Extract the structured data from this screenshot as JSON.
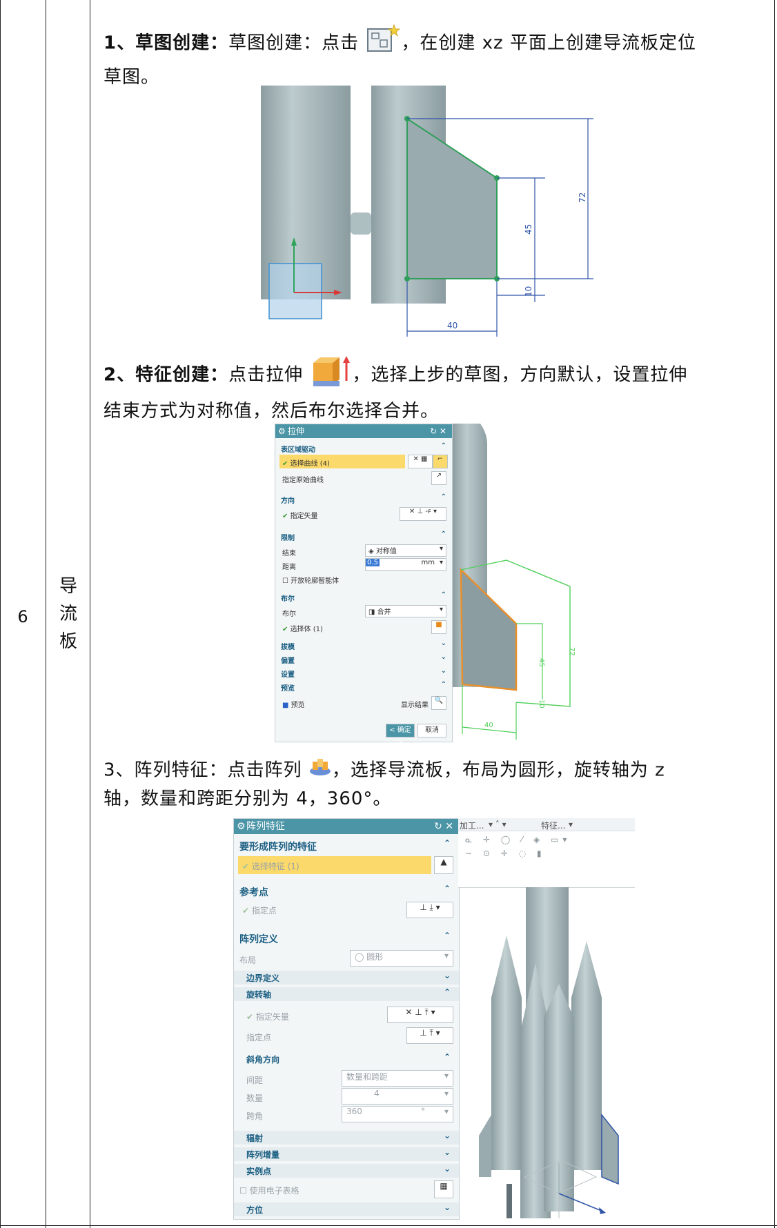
{
  "row": {
    "number": "6",
    "name": "导流板"
  },
  "step1": {
    "num": "1、",
    "heading": "草图创建：",
    "text_before_icon": "草图创建：点击",
    "text_after_icon": "，在创建 xz 平面上创建导流板定位",
    "text_line2": "草图。",
    "icon": "sketch-icon",
    "dimensions": {
      "height_total": "72",
      "height_upper": "45",
      "offset_bottom": "10",
      "width": "40"
    }
  },
  "step2": {
    "num": "2、",
    "heading": "特征创建：",
    "text_before_icon": "点击拉伸",
    "text_after_icon": "，选择上步的草图，方向默认，设置拉伸",
    "text_line2": "结束方式为对称值，然后布尔选择合并。",
    "icon": "extrude-icon",
    "dialog": {
      "title": "拉伸",
      "sec_section": "表区域驱动",
      "select_curve": "选择曲线 (4)",
      "origin_curve": "指定原始曲线",
      "sec_direction": "方向",
      "specify_vector": "指定矢量",
      "sec_limits": "限制",
      "end_label": "结束",
      "end_value": "对称值",
      "distance_label": "距离",
      "distance_value": "0.5",
      "distance_unit": "mm",
      "open_profile": "开放轮廓智能体",
      "sec_boolean": "布尔",
      "boolean_label": "布尔",
      "boolean_value": "合并",
      "select_body": "选择体 (1)",
      "sec_draft": "拔模",
      "sec_offset": "偏置",
      "sec_settings": "设置",
      "sec_preview": "预览",
      "preview_label": "预览",
      "show_result": "显示结果",
      "ok": "< 确定 >",
      "cancel": "取消"
    },
    "dimensions": {
      "height_total": "72",
      "height_upper": "45",
      "offset_bottom": "10",
      "width": "40"
    }
  },
  "step3": {
    "num": "3、",
    "heading": "阵列特征：",
    "text_before_icon": "点击阵列",
    "text_after_icon": "，选择导流板，布局为圆形，旋转轴为 z",
    "text_line2": "轴，数量和跨距分别为 4，360°。",
    "icon": "pattern-icon",
    "dialog": {
      "title": "阵列特征",
      "sec_features": "要形成阵列的特征",
      "select_feature": "选择特征 (1)",
      "sec_refpoint": "参考点",
      "specify_point": "指定点",
      "sec_define": "阵列定义",
      "layout_label": "布局",
      "layout_value": "圆形",
      "boundary": "边界定义",
      "rotation_axis": "旋转轴",
      "specify_vector": "指定矢量",
      "specify_point2": "指定点",
      "angle_dir": "斜角方向",
      "spacing_label": "间距",
      "spacing_value": "数量和跨距",
      "count_label": "数量",
      "count_value": "4",
      "span_label": "跨角",
      "span_value": "360",
      "span_unit": "°",
      "radiate": "辐射",
      "increment": "阵列增量",
      "instance": "实例点",
      "spreadsheet": "使用电子表格",
      "orientation": "方位"
    },
    "toolbar": {
      "menu1": "加工...",
      "menu2": "特征..."
    }
  },
  "colors": {
    "dialog_title": "#4b95a7",
    "section": "#1b5f83",
    "highlight": "#fbd96a",
    "model": "#a9babd",
    "sketch": "#2f9e5b"
  }
}
